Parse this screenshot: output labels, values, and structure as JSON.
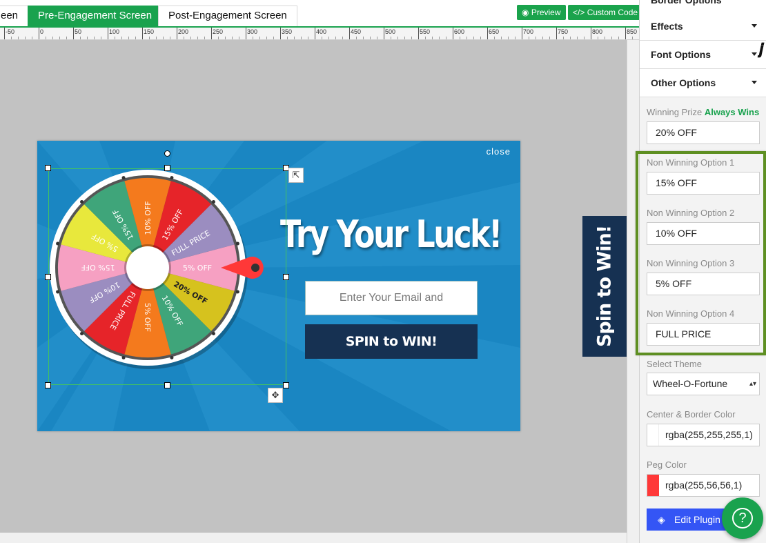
{
  "tabs": {
    "partial": "een",
    "pre": "Pre-Engagement Screen",
    "post": "Post-Engagement Screen"
  },
  "toolbar": {
    "preview": "Preview",
    "custom_code": "Custom Code",
    "preview_icon": "eye-icon",
    "code_icon": "code-icon"
  },
  "ruler": {
    "labels": [
      "-50",
      "0",
      "50",
      "100",
      "150",
      "200",
      "250",
      "300",
      "350",
      "400",
      "450",
      "500",
      "550",
      "600",
      "650",
      "700",
      "750",
      "800",
      "850"
    ]
  },
  "popup": {
    "close": "close",
    "headline": "Try Your Luck!",
    "email_placeholder": "Enter Your Email and",
    "spin_button": "SPIN to WIN!",
    "bg_color": "#1a86c2",
    "button_color": "#163152"
  },
  "wheel": {
    "segments": [
      {
        "label": "5% OFF",
        "color": "#f6a0c2"
      },
      {
        "label": "20% OFF",
        "color": "#d6c21e"
      },
      {
        "label": "10% OFF",
        "color": "#3fa57a"
      },
      {
        "label": "5% OFF",
        "color": "#f47a1d"
      },
      {
        "label": "FULL PRICE",
        "color": "#e62429"
      },
      {
        "label": "10% OFF",
        "color": "#9b8dc0"
      },
      {
        "label": "15% OFF",
        "color": "#f6a0c2"
      },
      {
        "label": "5% OFF",
        "color": "#e8e83c"
      },
      {
        "label": "15% OFF",
        "color": "#3fa57a"
      },
      {
        "label": "10% OFF",
        "color": "#f47a1d"
      },
      {
        "label": "15% OFF",
        "color": "#e62429"
      },
      {
        "label": "FULL PRICE",
        "color": "#9b8dc0"
      }
    ],
    "peg_color": "#ff3838"
  },
  "side_tab": {
    "label": "Spin to Win!"
  },
  "panel": {
    "accordions": [
      "Border Options",
      "Effects",
      "Font Options",
      "Other Options"
    ],
    "winning_label": "Winning Prize",
    "winning_badge": "Always Wins",
    "winning_value": "20% OFF",
    "non_winning": [
      {
        "label": "Non Winning Option 1",
        "value": "15% OFF"
      },
      {
        "label": "Non Winning Option 2",
        "value": "10% OFF"
      },
      {
        "label": "Non Winning Option 3",
        "value": "5% OFF"
      },
      {
        "label": "Non Winning Option 4",
        "value": "FULL PRICE"
      }
    ],
    "theme_label": "Select Theme",
    "theme_value": "Wheel-O-Fortune",
    "center_color_label": "Center & Border Color",
    "center_color_value": "rgba(255,255,255,1)",
    "peg_color_label": "Peg Color",
    "peg_color_value": "rgba(255,56,56,1)",
    "edit_plugin": "Edit Plugin",
    "help": "?"
  },
  "accent_color": "#19a24e",
  "highlight_color": "#5e8f22"
}
